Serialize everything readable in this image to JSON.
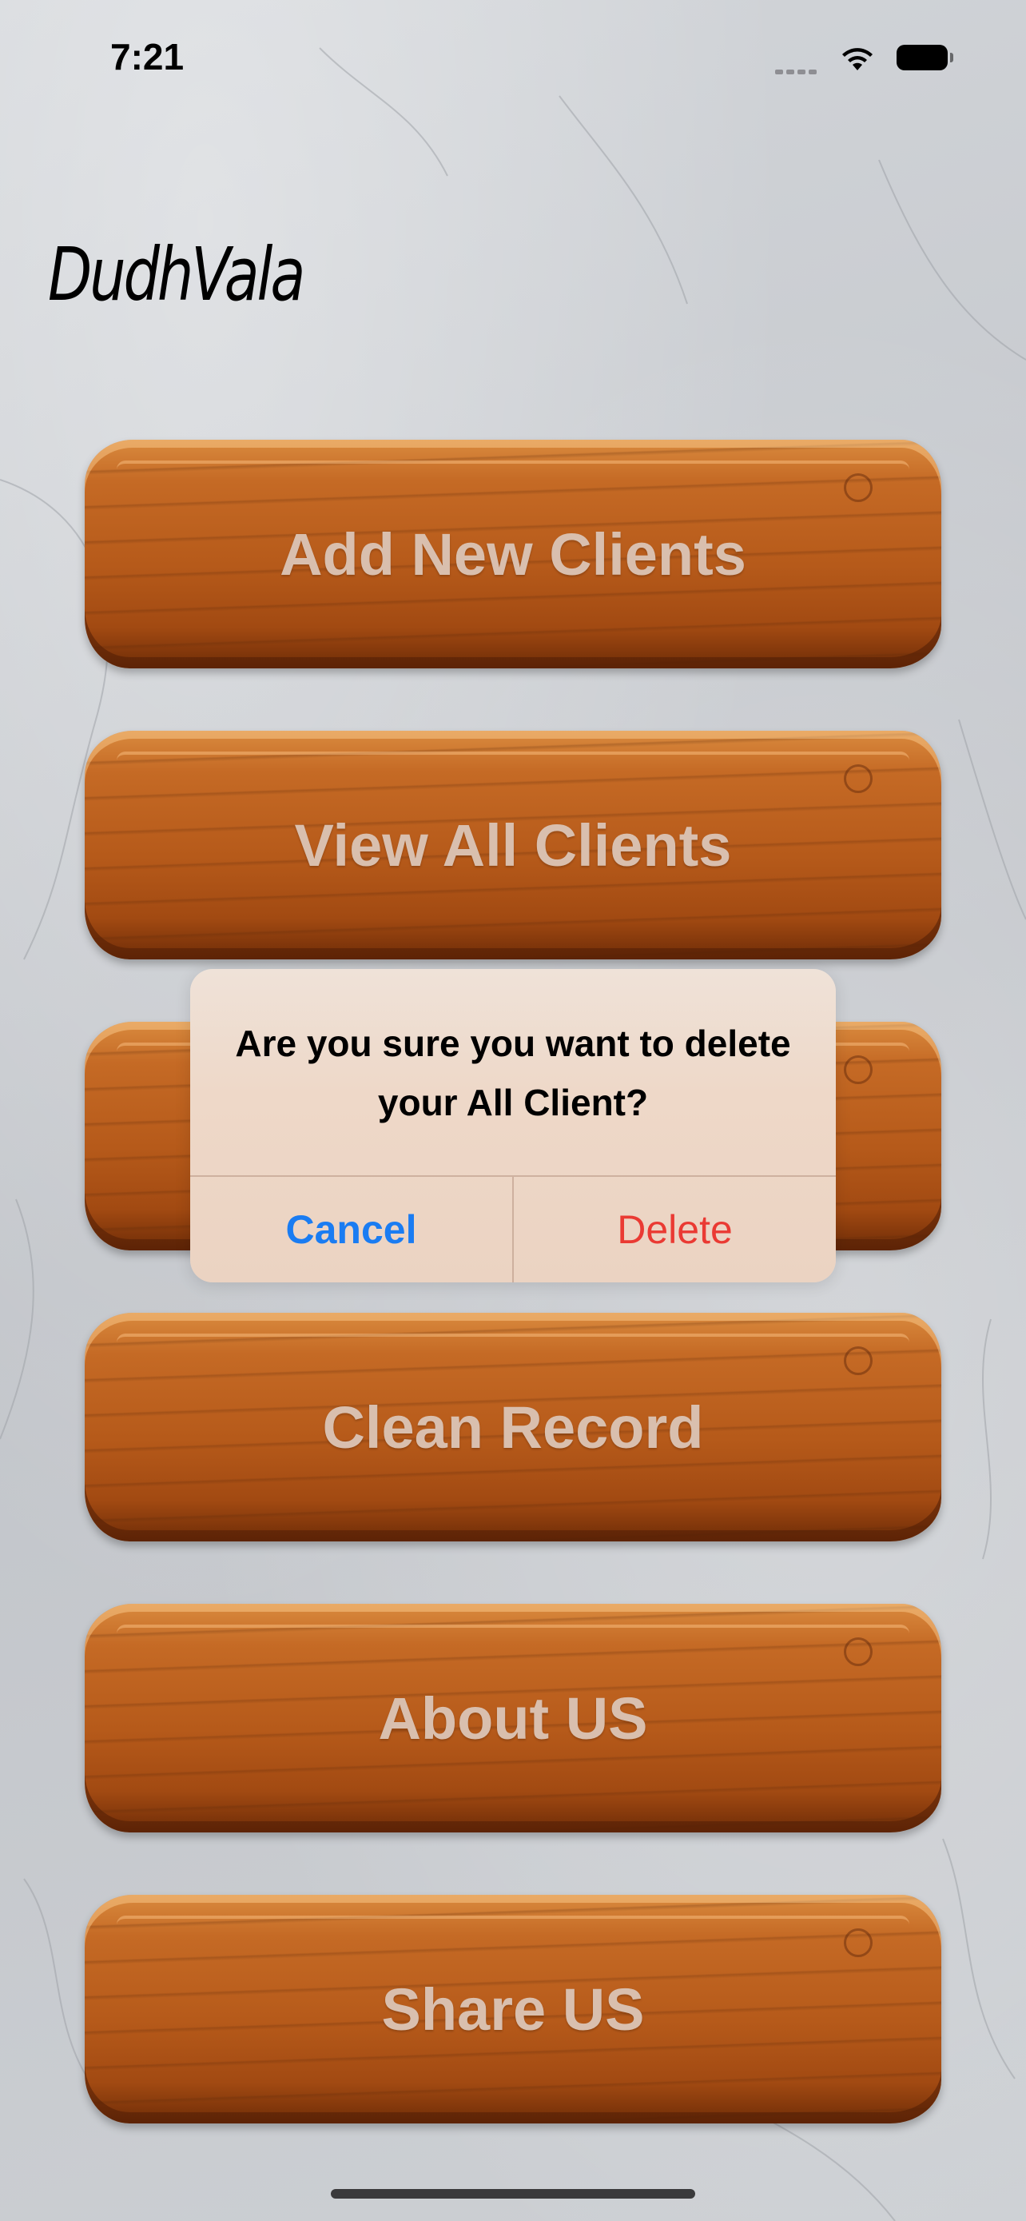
{
  "status_bar": {
    "time": "7:21"
  },
  "app": {
    "title": "DudhVala"
  },
  "menu": {
    "buttons": [
      {
        "label": "Add New Clients"
      },
      {
        "label": "View All Clients"
      },
      {
        "label": ""
      },
      {
        "label": "Clean Record"
      },
      {
        "label": "About US"
      },
      {
        "label": "Share US"
      }
    ]
  },
  "alert": {
    "message": "Are you sure you want to delete your All Client?",
    "cancel_label": "Cancel",
    "delete_label": "Delete",
    "cancel_color": "#1a7cf2",
    "delete_color": "#ea3a33"
  }
}
